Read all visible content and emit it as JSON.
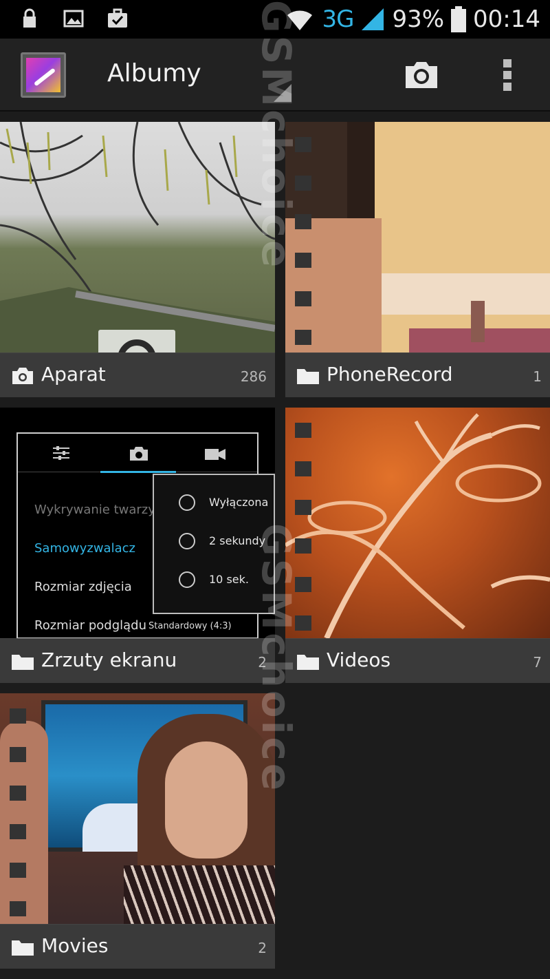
{
  "status_bar": {
    "network": "3G",
    "battery": "93%",
    "time": "00:14",
    "icons": [
      "lock-icon",
      "image-icon",
      "briefcase-check-icon",
      "wifi-icon",
      "signal-icon",
      "battery-icon"
    ]
  },
  "action_bar": {
    "title": "Albumy",
    "icons": [
      "gallery-app-icon",
      "camera-icon",
      "overflow-menu-icon"
    ]
  },
  "albums": [
    {
      "name": "Aparat",
      "count": "286",
      "icon": "camera-icon"
    },
    {
      "name": "PhoneRecord",
      "count": "1",
      "icon": "folder-icon"
    },
    {
      "name": "Zrzuty ekranu",
      "count": "2",
      "icon": "folder-icon"
    },
    {
      "name": "Videos",
      "count": "7",
      "icon": "folder-icon"
    },
    {
      "name": "Movies",
      "count": "2",
      "icon": "folder-icon"
    }
  ],
  "screenshot_thumb": {
    "rows": [
      "Wykrywanie twarzy",
      "Samowyzwalacz",
      "Rozmiar zdjęcia",
      "Rozmiar podglądu"
    ],
    "preview_value": "Standardowy (4:3)",
    "popup_options": [
      "Wyłączona",
      "2 sekundy",
      "10 sek."
    ]
  },
  "watermark": "GSMchoice",
  "colors": {
    "accent": "#33b5e5",
    "background": "#1c1c1c",
    "caption": "#3a3a3a"
  }
}
